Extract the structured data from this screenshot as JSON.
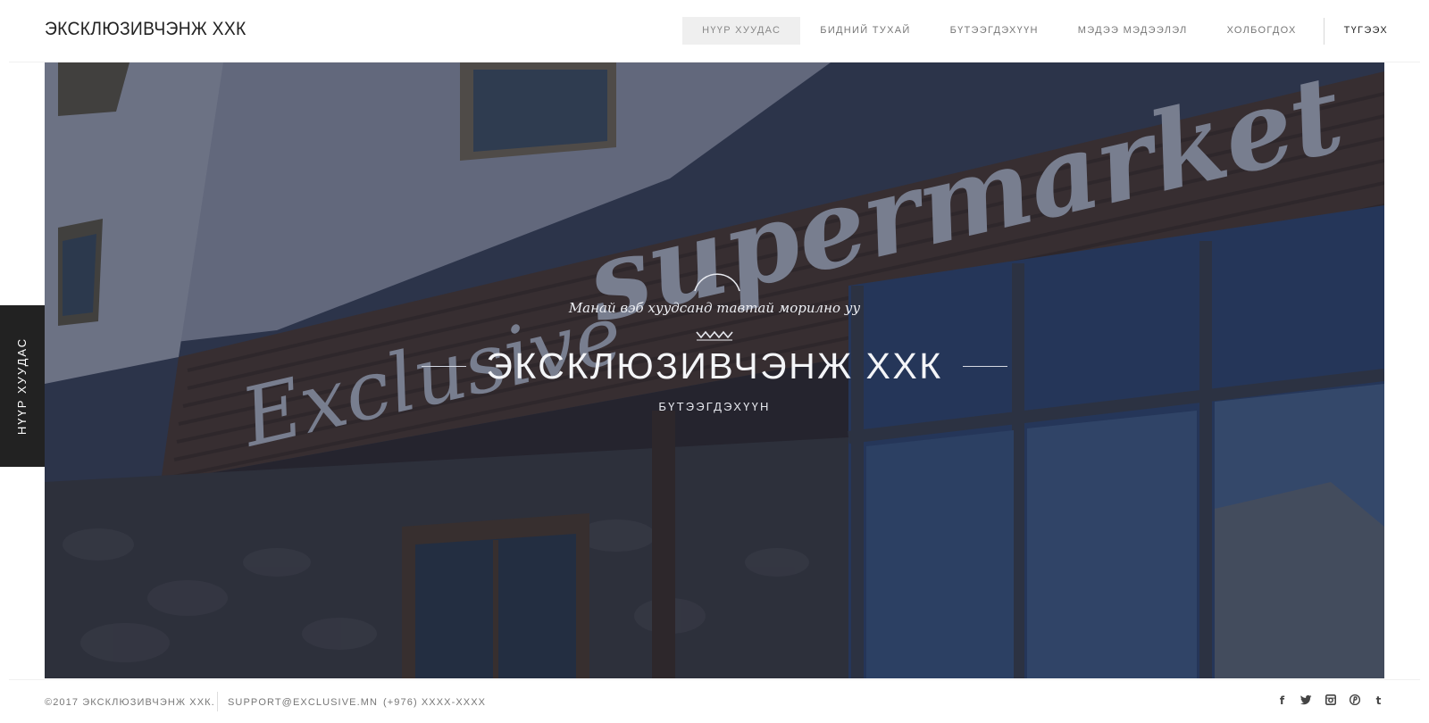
{
  "header": {
    "logo": "ЭКСКЛЮЗИВЧЭНЖ ХХК",
    "nav": [
      {
        "label": "НҮҮР ХУУДАС",
        "active": true
      },
      {
        "label": "БИДНИЙ ТУХАЙ"
      },
      {
        "label": "БҮТЭЭГДЭХҮҮН"
      },
      {
        "label": "МЭДЭЭ МЭДЭЭЛЭЛ"
      },
      {
        "label": "ХОЛБОГДОХ"
      }
    ],
    "exit_label": "ТҮГЭЭХ"
  },
  "hero": {
    "welcome": "Манай вэб хуудсанд тавтай морилно уу",
    "title": "ЭКСКЛЮЗИВЧЭНЖ ХХК",
    "subtitle": "БҮТЭЭГДЭХҮҮН",
    "sign_text": "Exclusive supermarket"
  },
  "side_tab": {
    "label": "НҮҮР ХУУДАС"
  },
  "footer": {
    "copyright": "©2017 ЭКСКЛЮЗИВЧЭНЖ ХХК.",
    "email": "SUPPORT@EXCLUSIVE.MN",
    "phone": "(+976) XXXX-XXXX",
    "socials": [
      "facebook-icon",
      "twitter-icon",
      "instagram-icon",
      "pinterest-icon",
      "tumblr-icon"
    ]
  },
  "colors": {
    "side_tab_bg": "#222222",
    "nav_active_bg": "#efefef",
    "hero_tint": "#2b3346"
  }
}
